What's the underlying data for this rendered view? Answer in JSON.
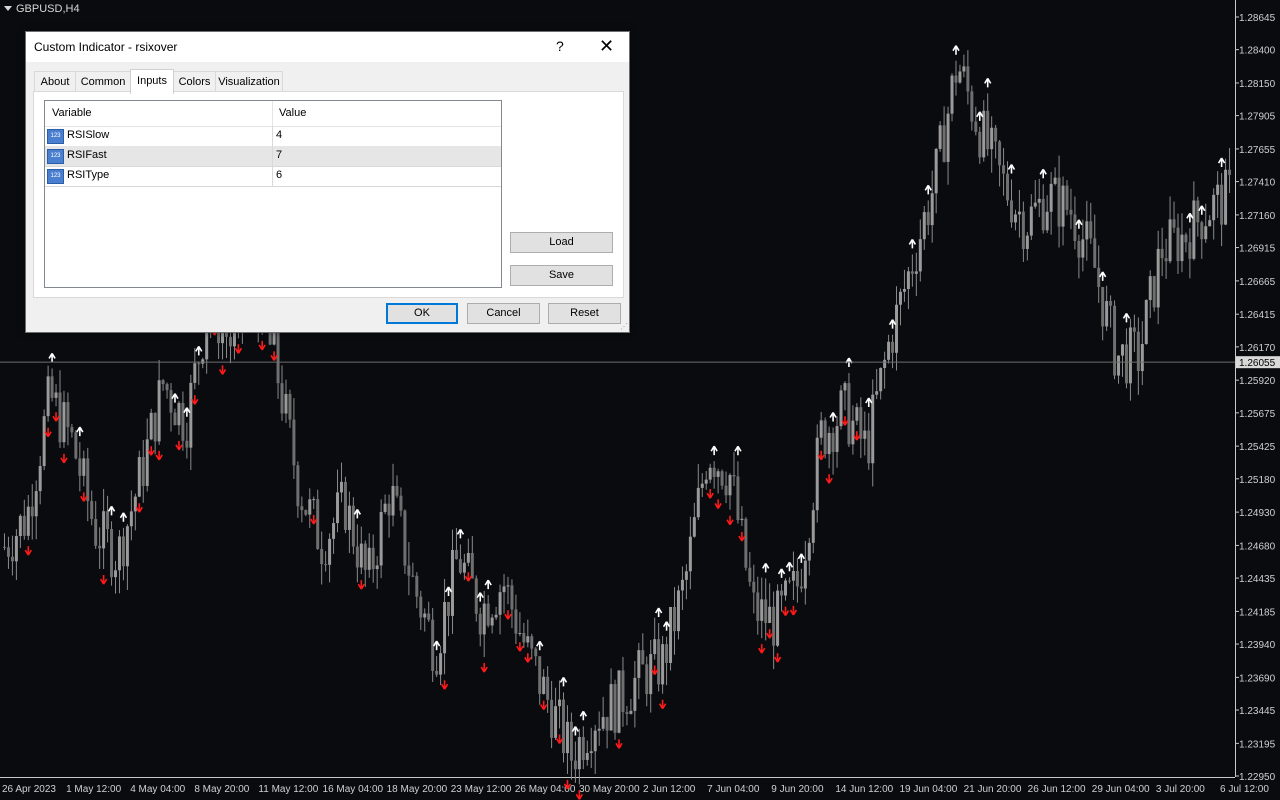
{
  "symbol": "GBPUSD,H4",
  "dialog": {
    "title": "Custom Indicator - rsixover",
    "help": "?",
    "close": "✕",
    "tabs": [
      "About",
      "Common",
      "Inputs",
      "Colors",
      "Visualization"
    ],
    "active_tab": "Inputs",
    "table": {
      "headers": [
        "Variable",
        "Value"
      ],
      "rows": [
        {
          "icon": "integer-param-icon",
          "icon_text": "123",
          "name": "RSISlow",
          "value": "4"
        },
        {
          "icon": "integer-param-icon",
          "icon_text": "123",
          "name": "RSIFast",
          "value": "7"
        },
        {
          "icon": "integer-param-icon",
          "icon_text": "123",
          "name": "RSIType",
          "value": "6"
        }
      ]
    },
    "buttons": {
      "load": "Load",
      "save": "Save",
      "ok": "OK",
      "cancel": "Cancel",
      "reset": "Reset"
    }
  },
  "chart_data": {
    "type": "candlestick",
    "symbol": "GBPUSD",
    "timeframe": "H4",
    "price_axis": [
      "1.28645",
      "1.28400",
      "1.28150",
      "1.27905",
      "1.27655",
      "1.27410",
      "1.27160",
      "1.26915",
      "1.26665",
      "1.26415",
      "1.26170",
      "1.25920",
      "1.25675",
      "1.25425",
      "1.25180",
      "1.24930",
      "1.24680",
      "1.24435",
      "1.24185",
      "1.23940",
      "1.23690",
      "1.23445",
      "1.23195",
      "1.22950"
    ],
    "current_price": "1.26055",
    "time_axis": [
      "26 Apr 2023",
      "1 May 12:00",
      "4 May 04:00",
      "8 May 20:00",
      "11 May 12:00",
      "16 May 04:00",
      "18 May 20:00",
      "23 May 12:00",
      "26 May 04:00",
      "30 May 20:00",
      "2 Jun 12:00",
      "7 Jun 04:00",
      "9 Jun 20:00",
      "14 Jun 12:00",
      "19 Jun 04:00",
      "21 Jun 20:00",
      "26 Jun 12:00",
      "29 Jun 04:00",
      "3 Jul 20:00",
      "6 Jul 12:00"
    ],
    "close_path": [
      1.2467,
      1.249,
      1.258,
      1.2545,
      1.248,
      1.246,
      1.252,
      1.259,
      1.256,
      1.265,
      1.262,
      1.266,
      1.26,
      1.251,
      1.247,
      1.25,
      1.244,
      1.251,
      1.244,
      1.239,
      1.246,
      1.242,
      1.244,
      1.239,
      1.235,
      1.231,
      1.234,
      1.235,
      1.237,
      1.238,
      1.244,
      1.254,
      1.252,
      1.242,
      1.241,
      1.244,
      1.255,
      1.257,
      1.254,
      1.262,
      1.268,
      1.274,
      1.283,
      1.278,
      1.274,
      1.271,
      1.273,
      1.272,
      1.268,
      1.261,
      1.261,
      1.269,
      1.27,
      1.272,
      1.273
    ],
    "signals_up": 46,
    "signals_down": 44
  }
}
